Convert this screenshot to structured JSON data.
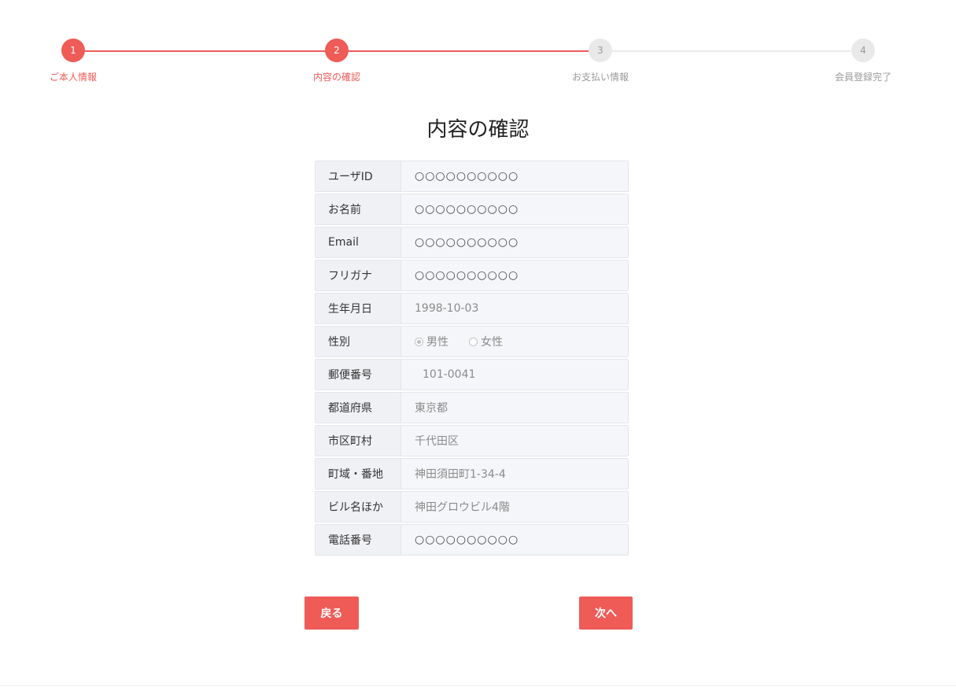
{
  "steps": [
    {
      "number": "1",
      "label": "ご本人情報",
      "state": "active"
    },
    {
      "number": "2",
      "label": "内容の確認",
      "state": "active"
    },
    {
      "number": "3",
      "label": "お支払い情報",
      "state": "inactive"
    },
    {
      "number": "4",
      "label": "会員登録完了",
      "state": "inactive"
    }
  ],
  "page_title": "内容の確認",
  "fields": {
    "user_id": {
      "label": "ユーザID",
      "value": "○○○○○○○○○○"
    },
    "name": {
      "label": "お名前",
      "value": "○○○○○○○○○○"
    },
    "email": {
      "label": "Email",
      "value": "○○○○○○○○○○"
    },
    "furigana": {
      "label": "フリガナ",
      "value": "○○○○○○○○○○"
    },
    "birthdate": {
      "label": "生年月日",
      "value": "1998-10-03"
    },
    "gender": {
      "label": "性別",
      "options": [
        "男性",
        "女性"
      ],
      "selected": "男性"
    },
    "postal_code": {
      "label": "郵便番号",
      "value": "101-0041"
    },
    "prefecture": {
      "label": "都道府県",
      "value": "東京都"
    },
    "city": {
      "label": "市区町村",
      "value": "千代田区"
    },
    "address": {
      "label": "町域・番地",
      "value": "神田須田町1-34-4"
    },
    "building": {
      "label": "ビル名ほか",
      "value": "神田グロウビル4階"
    },
    "phone": {
      "label": "電話番号",
      "value": "○○○○○○○○○○"
    }
  },
  "buttons": {
    "back": "戻る",
    "next": "次へ"
  },
  "colors": {
    "accent": "#ef5b57",
    "inactive": "#e9e9e9"
  }
}
